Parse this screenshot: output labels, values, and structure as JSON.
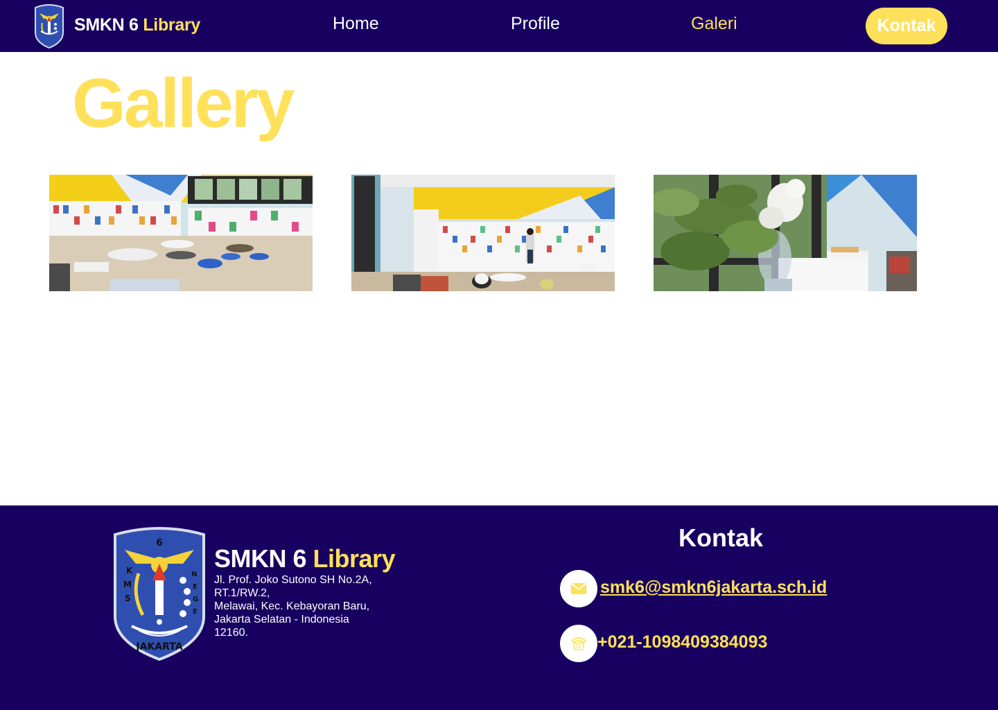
{
  "navbar": {
    "brand_part1": "SMKN 6",
    "brand_part2": "Library",
    "links": [
      "Home",
      "Profile",
      "Galeri"
    ],
    "active_link": "Galeri",
    "cta_label": "Kontak"
  },
  "page": {
    "title": "Gallery"
  },
  "gallery": {
    "photos": [
      {
        "subject": "library-reading-room"
      },
      {
        "subject": "library-bookshelves-students"
      },
      {
        "subject": "window-plant-and-flower"
      }
    ]
  },
  "footer": {
    "brand_part1": "SMKN 6",
    "brand_part2": "Library",
    "address_lines": [
      "Jl. Prof. Joko Sutono SH No.2A,",
      "RT.1/RW.2,",
      "Melawai, Kec. Kebayoran Baru,",
      "Jakarta Selatan - Indonesia",
      "12160."
    ],
    "contact_heading": "Kontak",
    "email": "smk6@smkn6jakarta.sch.id",
    "phone": "+021-1098409384093",
    "email_icon": "mail-icon",
    "phone_icon": "phone-icon"
  },
  "colors": {
    "primary": "#170060",
    "accent": "#FFE05A",
    "text_light": "#FFFFFF"
  }
}
